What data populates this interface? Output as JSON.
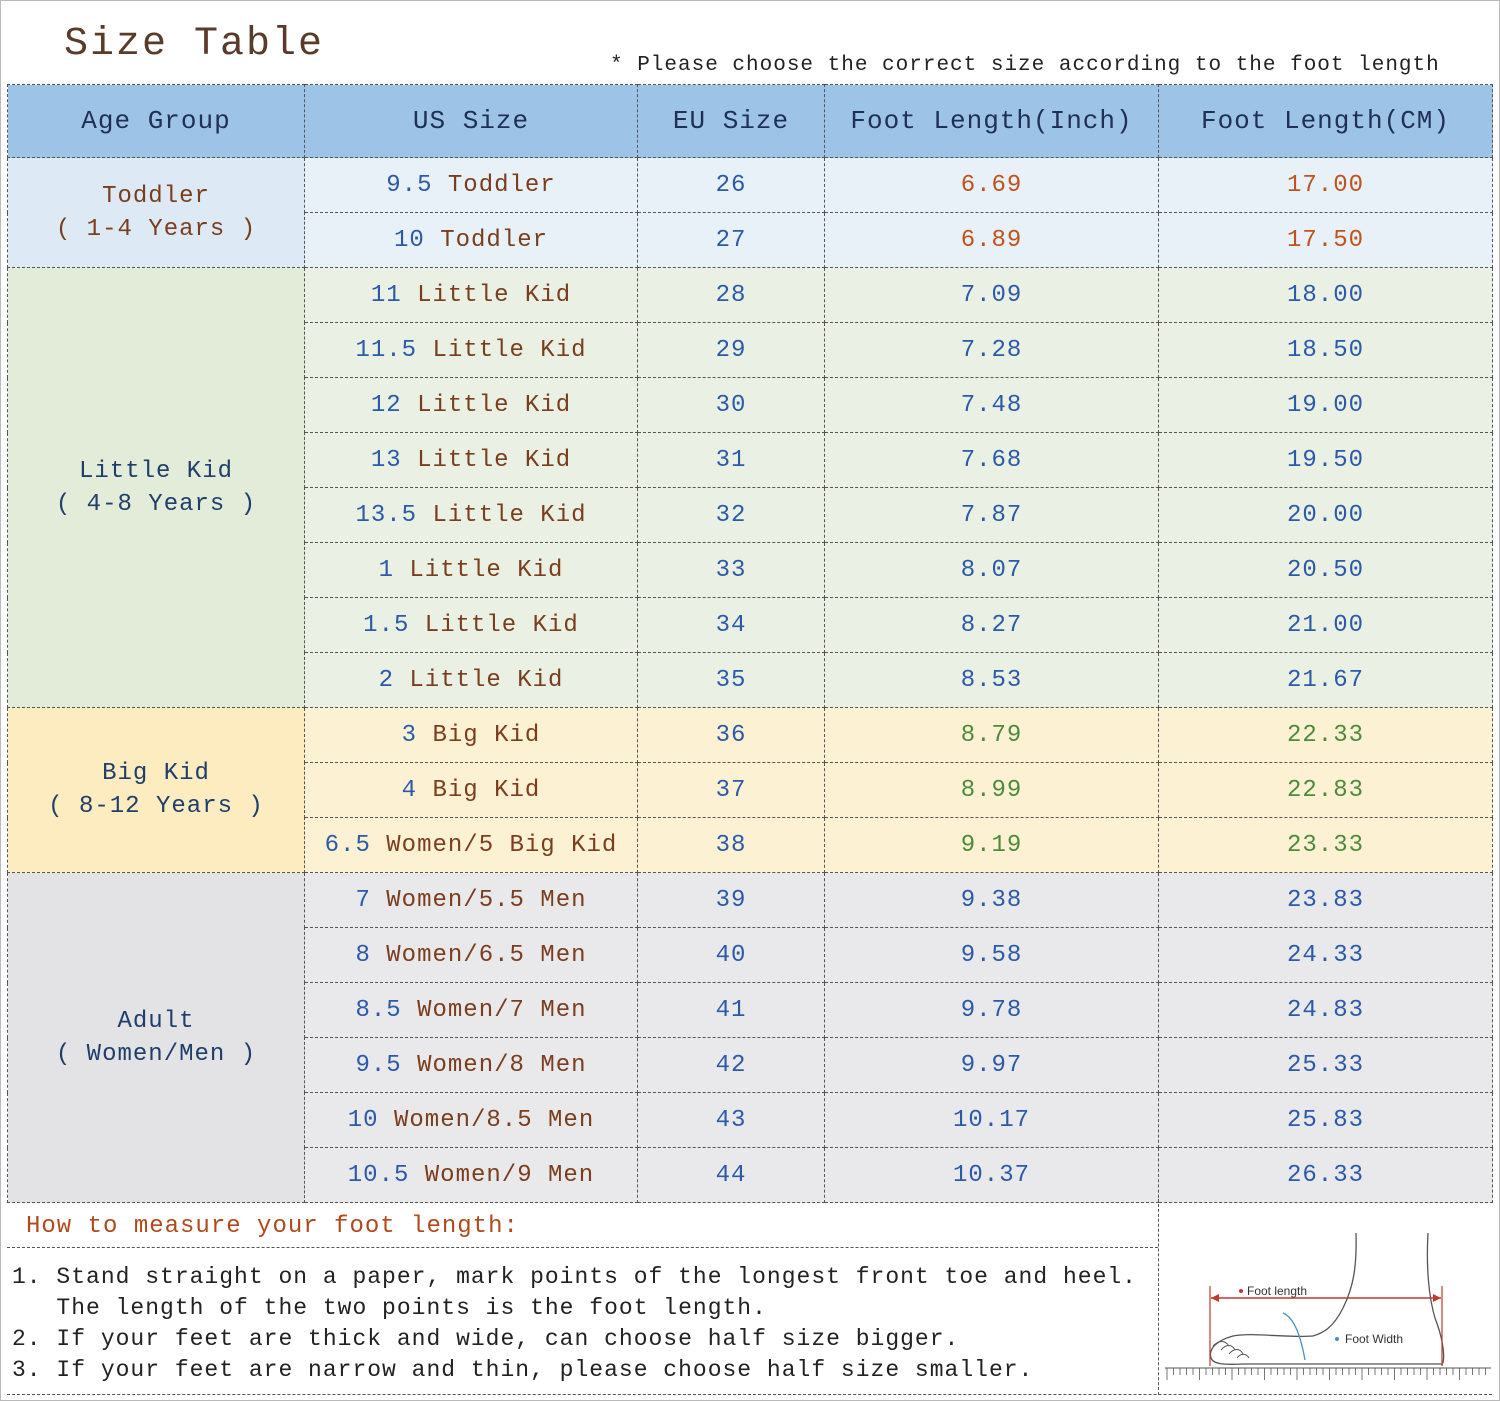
{
  "title": "Size Table",
  "note": "* Please choose the correct size according to the foot length",
  "headers": [
    "Age Group",
    "US Size",
    "EU Size",
    "Foot Length(Inch)",
    "Foot Length(CM)"
  ],
  "groups": {
    "toddler": {
      "line1": "Toddler",
      "line2": "( 1-4 Years )"
    },
    "little": {
      "line1": "Little Kid",
      "line2": "( 4-8 Years )"
    },
    "big": {
      "line1": "Big Kid",
      "line2": "( 8-12 Years )"
    },
    "adult": {
      "line1": "Adult",
      "line2": "( Women/Men )"
    }
  },
  "rows": [
    {
      "us_num": "9.5",
      "us_txt": "Toddler",
      "eu": "26",
      "inch": "6.69",
      "cm": "17.00"
    },
    {
      "us_num": "10",
      "us_txt": "Toddler",
      "eu": "27",
      "inch": "6.89",
      "cm": "17.50"
    },
    {
      "us_num": "11",
      "us_txt": "Little Kid",
      "eu": "28",
      "inch": "7.09",
      "cm": "18.00"
    },
    {
      "us_num": "11.5",
      "us_txt": "Little Kid",
      "eu": "29",
      "inch": "7.28",
      "cm": "18.50"
    },
    {
      "us_num": "12",
      "us_txt": "Little Kid",
      "eu": "30",
      "inch": "7.48",
      "cm": "19.00"
    },
    {
      "us_num": "13",
      "us_txt": "Little Kid",
      "eu": "31",
      "inch": "7.68",
      "cm": "19.50"
    },
    {
      "us_num": "13.5",
      "us_txt": "Little Kid",
      "eu": "32",
      "inch": "7.87",
      "cm": "20.00"
    },
    {
      "us_num": "1",
      "us_txt": "Little Kid",
      "eu": "33",
      "inch": "8.07",
      "cm": "20.50"
    },
    {
      "us_num": "1.5",
      "us_txt": "Little Kid",
      "eu": "34",
      "inch": "8.27",
      "cm": "21.00"
    },
    {
      "us_num": "2",
      "us_txt": "Little Kid",
      "eu": "35",
      "inch": "8.53",
      "cm": "21.67"
    },
    {
      "us_num": "3",
      "us_txt": "Big Kid",
      "eu": "36",
      "inch": "8.79",
      "cm": "22.33"
    },
    {
      "us_num": "4",
      "us_txt": "Big Kid",
      "eu": "37",
      "inch": "8.99",
      "cm": "22.83"
    },
    {
      "us_num": "6.5",
      "us_txt": "Women/5 Big Kid",
      "eu": "38",
      "inch": "9.19",
      "cm": "23.33"
    },
    {
      "us_num": "7",
      "us_txt": "Women/5.5 Men",
      "eu": "39",
      "inch": "9.38",
      "cm": "23.83"
    },
    {
      "us_num": "8",
      "us_txt": "Women/6.5 Men",
      "eu": "40",
      "inch": "9.58",
      "cm": "24.33"
    },
    {
      "us_num": "8.5",
      "us_txt": "Women/7 Men",
      "eu": "41",
      "inch": "9.78",
      "cm": "24.83"
    },
    {
      "us_num": "9.5",
      "us_txt": "Women/8 Men",
      "eu": "42",
      "inch": "9.97",
      "cm": "25.33"
    },
    {
      "us_num": "10",
      "us_txt": "Women/8.5 Men",
      "eu": "43",
      "inch": "10.17",
      "cm": "25.83"
    },
    {
      "us_num": "10.5",
      "us_txt": "Women/9 Men",
      "eu": "44",
      "inch": "10.37",
      "cm": "26.33"
    }
  ],
  "measure": {
    "heading": "How to measure your foot length:",
    "steps": [
      "1. Stand straight on a paper, mark points of the longest front toe and heel.",
      "   The length of the two points is the foot length.",
      "2. If your feet are thick and wide, can choose half size bigger.",
      "3. If your feet are narrow and thin, please choose half size smaller."
    ],
    "diagram_labels": {
      "length": "Foot length",
      "width": "Foot Width"
    }
  },
  "colors": {
    "header_bg": "#9dc3e6",
    "toddler_bg": "#e8f0f8",
    "little_bg": "#eaf1e4",
    "big_bg": "#fdf1d3",
    "adult_bg": "#e9e8ea",
    "accent_brown": "#7a3e1d",
    "accent_blue": "#2a5aa8"
  },
  "icons": [
    "foot-diagram-icon",
    "ruler-icon"
  ]
}
